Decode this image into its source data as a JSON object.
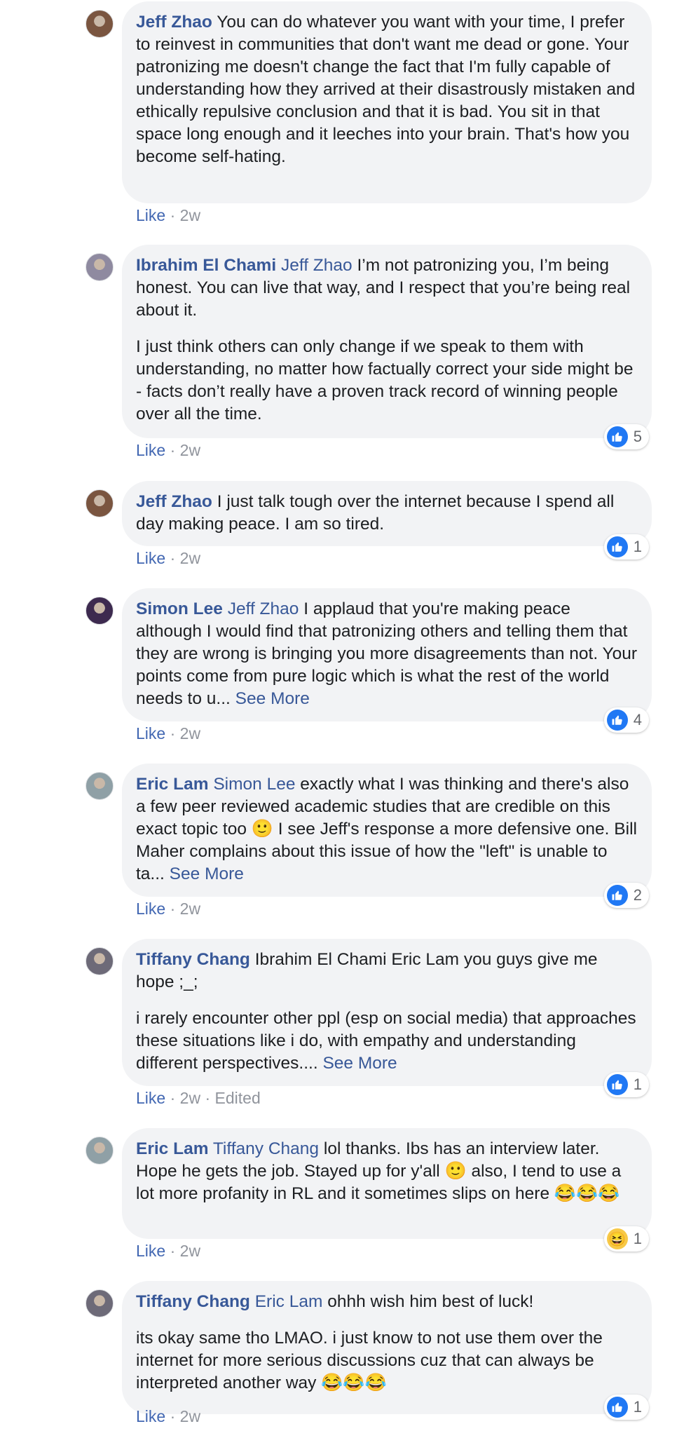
{
  "theme": {
    "name_color": "#385898",
    "like_color": "#4267b2",
    "meta_color": "#90949c",
    "bubble_bg": "#f2f3f5",
    "reaction_like": "#2078f4"
  },
  "comments": [
    {
      "author": "Jeff Zhao",
      "paragraphs": [
        {
          "mention": "",
          "text": "You can do whatever you want with your time, I prefer to reinvest in communities that don't want me dead or gone. Your patronizing me doesn't change the fact that I'm fully capable of understanding how they arrived at their disastrously mistaken and ethically repulsive conclusion and that it is bad. You sit in that space long enough and it leeches into your brain. That's how you become self-hating."
        }
      ],
      "like": "Like",
      "time": "2w",
      "edited": "",
      "reaction": null
    },
    {
      "author": "Ibrahim El Chami",
      "paragraphs": [
        {
          "mention": "Jeff Zhao",
          "text": "I’m not patronizing you, I’m being honest. You can live that way, and I respect that you’re being real about it."
        },
        {
          "mention": "",
          "text": "I just think others can only change if we speak to them with understanding, no matter how factually correct your side might be - facts don’t really have a proven track record of winning people over all the time."
        }
      ],
      "like": "Like",
      "time": "2w",
      "edited": "",
      "reaction": {
        "icon": "thumbs-up-icon",
        "count": "5"
      }
    },
    {
      "author": "Jeff Zhao",
      "paragraphs": [
        {
          "mention": "",
          "text": "I just talk tough over the internet because I spend all day making peace. I am so tired."
        }
      ],
      "like": "Like",
      "time": "2w",
      "edited": "",
      "reaction": {
        "icon": "thumbs-up-icon",
        "count": "1"
      }
    },
    {
      "author": "Simon Lee",
      "paragraphs": [
        {
          "mention": "Jeff Zhao",
          "text": "I applaud that you're making peace although I would find that patronizing others and telling them that they are wrong is bringing you more disagreements than not. Your points come from pure logic which is what the rest of the world needs to u...",
          "see_more": "See More"
        }
      ],
      "like": "Like",
      "time": "2w",
      "edited": "",
      "reaction": {
        "icon": "thumbs-up-icon",
        "count": "4"
      }
    },
    {
      "author": "Eric Lam",
      "paragraphs": [
        {
          "mention": "Simon Lee",
          "text": "exactly what I was thinking and there's also a few peer reviewed academic studies that are credible on this exact topic too",
          "emoji": "🙂",
          "text2": "I see Jeff's response a more defensive one. Bill Maher complains about this issue of how the \"left\" is unable to ta...",
          "see_more": "See More"
        }
      ],
      "like": "Like",
      "time": "2w",
      "edited": "",
      "reaction": {
        "icon": "thumbs-up-icon",
        "count": "2"
      }
    },
    {
      "author": "Tiffany Chang",
      "paragraphs": [
        {
          "mention": "",
          "text": "Ibrahim El Chami Eric Lam you guys give me hope ;_;"
        },
        {
          "mention": "",
          "text": "i rarely encounter other ppl (esp on social media) that approaches these situations like i do, with empathy and understanding different perspectives....",
          "see_more": "See More"
        }
      ],
      "like": "Like",
      "time": "2w",
      "edited": "Edited",
      "reaction": {
        "icon": "thumbs-up-icon",
        "count": "1"
      }
    },
    {
      "author": "Eric Lam",
      "paragraphs": [
        {
          "mention": "Tiffany Chang",
          "text": "lol thanks. Ibs has an interview later. Hope he gets the job. Stayed up for y'all",
          "emoji": "🙂",
          "text2": "also, I tend to use a lot more profanity in RL and it sometimes slips on here",
          "emoji2": "😂😂😂"
        }
      ],
      "like": "Like",
      "time": "2w",
      "edited": "",
      "reaction": {
        "icon": "laughing-face-icon",
        "count": "1"
      }
    },
    {
      "author": "Tiffany Chang",
      "paragraphs": [
        {
          "mention": "Eric Lam",
          "text": "ohhh wish him best of luck!"
        },
        {
          "mention": "",
          "text": "its okay same tho LMAO. i just know to not use them over the internet for more serious discussions cuz that can always be interpreted another way",
          "emoji2": "😂😂😂"
        }
      ],
      "like": "Like",
      "time": "2w",
      "edited": "",
      "reaction": {
        "icon": "thumbs-up-icon",
        "count": "1"
      }
    }
  ]
}
